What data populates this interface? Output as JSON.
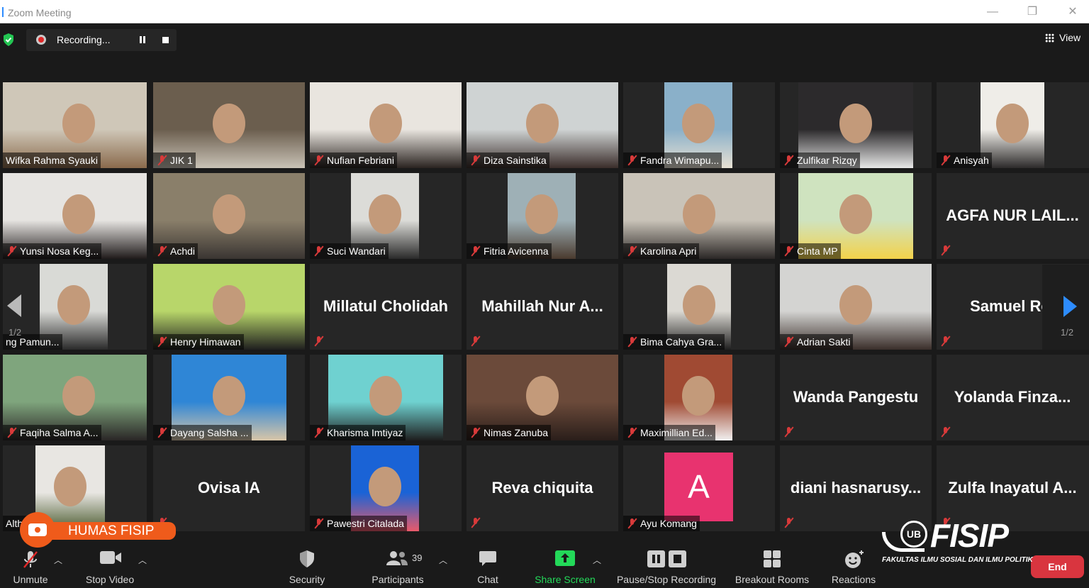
{
  "window": {
    "title": "Zoom Meeting",
    "minimize": "—",
    "restore": "❐",
    "close": "✕"
  },
  "recording": {
    "label": "Recording..."
  },
  "view": {
    "label": "View"
  },
  "pagination": {
    "left_count": "1/2",
    "right_count": "1/2"
  },
  "tiles": [
    {
      "name": "Wifka Rahma Syauki",
      "display": "video",
      "muted": false
    },
    {
      "name": "JIK 1",
      "display": "video",
      "muted": true
    },
    {
      "name": "Nufian Febriani",
      "display": "video",
      "muted": true
    },
    {
      "name": "Diza Sainstika",
      "display": "video",
      "muted": true
    },
    {
      "name": "Fandra Wimapu...",
      "display": "video",
      "muted": true
    },
    {
      "name": "Zulfikar Rizqy",
      "display": "video",
      "muted": true
    },
    {
      "name": "Anisyah",
      "display": "video",
      "muted": true
    },
    {
      "name": "Yunsi Nosa Keg...",
      "display": "video",
      "muted": true
    },
    {
      "name": "Achdi",
      "display": "video",
      "muted": true
    },
    {
      "name": "Suci Wandari",
      "display": "video",
      "muted": true
    },
    {
      "name": "Fitria Avicenna",
      "display": "video",
      "muted": true
    },
    {
      "name": "Karolina Apri",
      "display": "video",
      "muted": true
    },
    {
      "name": "Cinta MP",
      "display": "video",
      "muted": true
    },
    {
      "name": "AGFA NUR LAIL...",
      "display": "text",
      "muted": true
    },
    {
      "name": "ng Pamun...",
      "display": "video",
      "muted": false
    },
    {
      "name": "Henry Himawan",
      "display": "video",
      "muted": true
    },
    {
      "name": "Millatul Cholidah",
      "display": "text",
      "muted": true
    },
    {
      "name": "Mahillah Nur A...",
      "display": "text",
      "muted": true
    },
    {
      "name": "Bima Cahya Gra...",
      "display": "video",
      "muted": true
    },
    {
      "name": "Adrian Sakti",
      "display": "video",
      "muted": true
    },
    {
      "name": "Samuel Rol",
      "display": "text",
      "muted": true
    },
    {
      "name": "Faqiha Salma A...",
      "display": "video",
      "muted": true
    },
    {
      "name": "Dayang Salsha ...",
      "display": "video",
      "muted": true
    },
    {
      "name": "Kharisma Imtiyaz",
      "display": "video",
      "muted": true
    },
    {
      "name": "Nimas Zanuba",
      "display": "video",
      "muted": true
    },
    {
      "name": "Maximillian Ed...",
      "display": "video",
      "muted": true
    },
    {
      "name": "Wanda Pangestu",
      "display": "text",
      "muted": true
    },
    {
      "name": "Yolanda Finza...",
      "display": "text",
      "muted": true
    },
    {
      "name": "Althe",
      "display": "video",
      "muted": false
    },
    {
      "name": "Ovisa IA",
      "display": "text",
      "muted": true
    },
    {
      "name": "Pawestri Citalada",
      "display": "video",
      "muted": true
    },
    {
      "name": "Reva chiquita",
      "display": "text",
      "muted": true
    },
    {
      "name": "Ayu Komang",
      "display": "avatar",
      "avatar_letter": "A",
      "muted": true
    },
    {
      "name": "diani hasnarusy...",
      "display": "text",
      "muted": true
    },
    {
      "name": "Zulfa Inayatul A...",
      "display": "text",
      "muted": true
    }
  ],
  "toolbar": {
    "unmute": "Unmute",
    "stop_video": "Stop Video",
    "security": "Security",
    "participants": "Participants",
    "participants_count": "39",
    "chat": "Chat",
    "share_screen": "Share Screen",
    "pause_stop_recording": "Pause/Stop Recording",
    "breakout_rooms": "Breakout Rooms",
    "reactions": "Reactions",
    "end": "End"
  },
  "watermark": {
    "humas": "HUMAS FISIP",
    "fisip_logo": "FISIP",
    "ub": "UB",
    "fisip_sub": "FAKULTAS ILMU SOSIAL DAN ILMU POLITIK"
  },
  "colors": {
    "accent_blue": "#2d8cff",
    "share_green": "#23d959",
    "end_red": "#d9353f",
    "active_speaker": "#d9ef49",
    "muted_red": "#d83a3a",
    "avatar_pink": "#e8336f",
    "humas_orange": "#ef5b1b"
  }
}
